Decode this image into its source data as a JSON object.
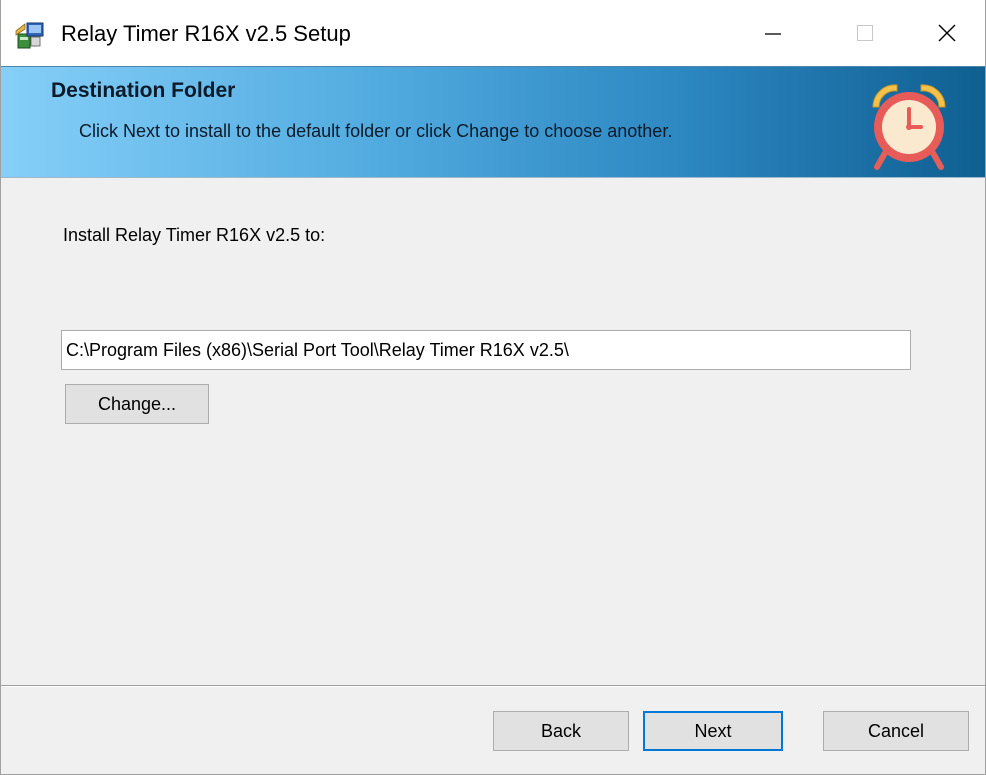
{
  "window": {
    "title": "Relay Timer R16X v2.5 Setup",
    "controls": {
      "minimize_icon": "minimize-icon",
      "maximize_icon": "maximize-icon",
      "close_icon": "close-icon"
    }
  },
  "banner": {
    "title": "Destination Folder",
    "description": "Click Next to install to the default folder or click Change to choose another.",
    "icon": "alarm-clock-icon"
  },
  "content": {
    "install_label": "Install Relay Timer R16X v2.5 to:",
    "path_value": "C:\\Program Files (x86)\\Serial Port Tool\\Relay Timer R16X v2.5\\",
    "change_label": "Change..."
  },
  "footer": {
    "back_label": "Back",
    "next_label": "Next",
    "cancel_label": "Cancel"
  },
  "colors": {
    "banner_start": "#85cff8",
    "banner_end": "#0f5f91",
    "default_button_border": "#0078d7",
    "dialog_background": "#f0f0f0"
  }
}
